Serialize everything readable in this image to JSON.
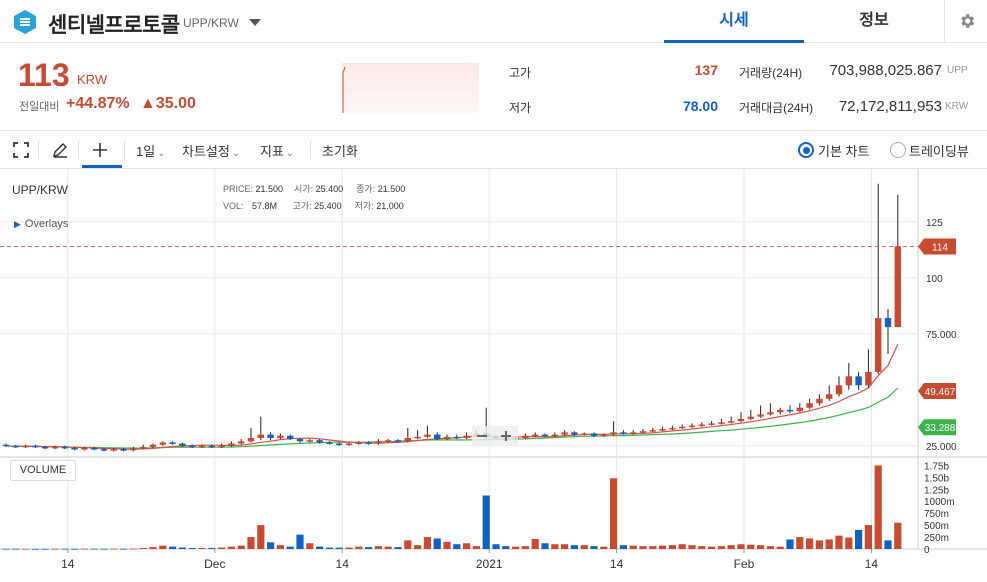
{
  "header": {
    "coin_name": "센티넬프로토콜",
    "pair": "UPP/KRW",
    "tabs": [
      "시세",
      "정보"
    ]
  },
  "price": {
    "current": "113",
    "unit": "KRW",
    "change_label": "전일대비",
    "change_pct": "+44.87%",
    "change_amt": "▲35.00"
  },
  "stats": {
    "high_label": "고가",
    "high_value": "137",
    "low_label": "저가",
    "low_value": "78.00",
    "volume_label": "거래량(24H)",
    "volume_value": "703,988,025.867",
    "volume_unit": "UPP",
    "amount_label": "거래대금(24H)",
    "amount_value": "72,172,811,953",
    "amount_unit": "KRW"
  },
  "toolbar": {
    "interval": "1일",
    "chart_settings": "차트설정",
    "indicators": "지표",
    "reset": "초기화",
    "basic_chart": "기본 차트",
    "trading_view": "트레이딩뷰"
  },
  "colors": {
    "up": "#c84a31",
    "down": "#1261c4",
    "ma_short": "#d9534f",
    "ma_long": "#3cb44b"
  },
  "chart": {
    "symbol": "UPP/KRW",
    "overlays": "Overlays",
    "volume_label": "VOLUME",
    "ohlc": {
      "price_k": "PRICE:",
      "price_v": "21.500",
      "open_k": "시가:",
      "open_v": "25.400",
      "close_k": "종가:",
      "close_v": "21.500",
      "vol_k": "VOL:",
      "vol_v": "57.8M",
      "high_k": "고가:",
      "high_v": "25.400",
      "low_k": "저가:",
      "low_v": "21.000"
    },
    "y_ticks": [
      "125",
      "100",
      "75.000",
      "25.000"
    ],
    "vol_ticks": [
      "1.75b",
      "1.50b",
      "1.25b",
      "1000m",
      "750m",
      "500m",
      "250m",
      "0"
    ],
    "x_ticks": [
      "14",
      "Dec",
      "14",
      "2021",
      "14",
      "Feb",
      "14"
    ],
    "price_tags": [
      {
        "label": "114",
        "value": 114,
        "color": "#c84a31"
      },
      {
        "label": "49.467",
        "value": 49.467,
        "color": "#c84a31"
      },
      {
        "label": "33.288",
        "value": 33.288,
        "color": "#3cb44b"
      }
    ]
  },
  "chart_data": {
    "type": "candlestick",
    "y_range": [
      20,
      145
    ],
    "vol_range": [
      0,
      1.8
    ],
    "candles": [
      [
        0,
        25.5,
        25.0,
        26.0,
        24.5,
        0.005
      ],
      [
        1,
        25.0,
        24.5,
        25.5,
        24.0,
        0.004
      ],
      [
        2,
        24.5,
        25.0,
        25.5,
        24.0,
        0.004
      ],
      [
        3,
        25.0,
        24.5,
        25.5,
        24.0,
        0.003
      ],
      [
        4,
        24.5,
        24.0,
        25.0,
        23.5,
        0.003
      ],
      [
        5,
        24.0,
        24.5,
        25.0,
        23.5,
        0.004
      ],
      [
        6,
        24.5,
        24.0,
        25.0,
        23.5,
        0.005
      ],
      [
        7,
        24.0,
        23.5,
        24.5,
        23.0,
        0.004
      ],
      [
        8,
        23.5,
        24.0,
        24.5,
        23.0,
        0.006
      ],
      [
        9,
        24.0,
        23.5,
        24.5,
        23.0,
        0.005
      ],
      [
        10,
        23.5,
        23.0,
        24.0,
        22.5,
        0.004
      ],
      [
        11,
        23.0,
        23.5,
        24.0,
        22.5,
        0.006
      ],
      [
        12,
        23.5,
        23.0,
        24.0,
        22.5,
        0.005
      ],
      [
        13,
        23.0,
        23.8,
        24.5,
        22.5,
        0.008
      ],
      [
        14,
        23.8,
        24.5,
        25.5,
        23.5,
        0.02
      ],
      [
        15,
        24.5,
        25.5,
        26.0,
        24.0,
        0.04
      ],
      [
        16,
        25.5,
        26.5,
        27.0,
        25.0,
        0.07
      ],
      [
        17,
        26.5,
        26.0,
        27.0,
        25.5,
        0.05
      ],
      [
        18,
        26.0,
        25.0,
        26.5,
        24.5,
        0.03
      ],
      [
        19,
        25.0,
        24.5,
        25.5,
        24.0,
        0.02
      ],
      [
        20,
        24.5,
        25.0,
        25.5,
        24.0,
        0.02
      ],
      [
        21,
        25.0,
        24.5,
        25.5,
        24.0,
        0.02
      ],
      [
        22,
        24.5,
        25.0,
        26.0,
        24.0,
        0.03
      ],
      [
        23,
        25.0,
        26.0,
        27.0,
        24.5,
        0.05
      ],
      [
        24,
        26.0,
        27.0,
        28.0,
        25.5,
        0.07
      ],
      [
        25,
        27.0,
        28.5,
        33.0,
        26.5,
        0.25
      ],
      [
        26,
        28.5,
        30.0,
        38.0,
        27.5,
        0.5
      ],
      [
        27,
        30.0,
        28.5,
        31.0,
        27.5,
        0.14
      ],
      [
        28,
        28.5,
        29.5,
        30.5,
        28.0,
        0.08
      ],
      [
        29,
        29.5,
        28.0,
        30.0,
        27.5,
        0.05
      ],
      [
        30,
        28.0,
        27.0,
        28.5,
        26.5,
        0.3
      ],
      [
        31,
        27.0,
        27.5,
        28.0,
        26.5,
        0.12
      ],
      [
        32,
        27.5,
        26.5,
        28.0,
        26.0,
        0.05
      ],
      [
        33,
        26.5,
        26.0,
        27.0,
        25.5,
        0.03
      ],
      [
        34,
        26.0,
        25.5,
        26.5,
        25.0,
        0.03
      ],
      [
        35,
        25.5,
        26.0,
        26.5,
        25.0,
        0.03
      ],
      [
        36,
        26.0,
        26.5,
        27.0,
        25.5,
        0.05
      ],
      [
        37,
        26.5,
        26.0,
        27.0,
        25.5,
        0.04
      ],
      [
        38,
        26.0,
        27.0,
        28.0,
        25.5,
        0.06
      ],
      [
        39,
        27.0,
        27.5,
        28.0,
        26.5,
        0.05
      ],
      [
        40,
        27.5,
        27.0,
        28.0,
        26.5,
        0.04
      ],
      [
        41,
        27.0,
        28.5,
        33.0,
        26.5,
        0.18
      ],
      [
        42,
        28.5,
        29.0,
        32.0,
        28.0,
        0.08
      ],
      [
        43,
        29.0,
        30.0,
        34.0,
        28.5,
        0.25
      ],
      [
        44,
        30.0,
        28.0,
        31.0,
        27.5,
        0.22
      ],
      [
        45,
        28.0,
        29.0,
        30.0,
        27.5,
        0.15
      ],
      [
        46,
        29.0,
        28.5,
        30.0,
        28.0,
        0.1
      ],
      [
        47,
        28.5,
        29.5,
        31.0,
        28.0,
        0.12
      ],
      [
        48,
        29.5,
        30.5,
        32.0,
        29.0,
        0.06
      ],
      [
        49,
        30.5,
        29.0,
        42.0,
        28.0,
        1.12
      ],
      [
        50,
        29.0,
        28.5,
        30.0,
        28.0,
        0.1
      ],
      [
        51,
        28.5,
        28.0,
        29.0,
        27.5,
        0.06
      ],
      [
        52,
        28.0,
        28.5,
        29.5,
        27.5,
        0.05
      ],
      [
        53,
        28.5,
        29.5,
        30.5,
        28.0,
        0.06
      ],
      [
        54,
        29.5,
        30.0,
        31.0,
        29.0,
        0.21
      ],
      [
        55,
        30.0,
        29.5,
        30.5,
        29.0,
        0.12
      ],
      [
        56,
        29.5,
        30.0,
        31.0,
        29.0,
        0.1
      ],
      [
        57,
        30.0,
        31.0,
        32.0,
        29.5,
        0.1
      ],
      [
        58,
        31.0,
        30.0,
        31.5,
        29.5,
        0.08
      ],
      [
        59,
        30.0,
        30.5,
        31.0,
        29.5,
        0.08
      ],
      [
        60,
        30.5,
        29.5,
        31.0,
        29.0,
        0.06
      ],
      [
        61,
        29.5,
        30.0,
        30.5,
        29.0,
        0.05
      ],
      [
        62,
        30.0,
        31.0,
        36.0,
        29.5,
        1.48
      ],
      [
        63,
        31.0,
        30.5,
        32.0,
        30.0,
        0.08
      ],
      [
        64,
        30.5,
        31.0,
        32.0,
        30.0,
        0.07
      ],
      [
        65,
        31.0,
        31.5,
        32.5,
        30.5,
        0.06
      ],
      [
        66,
        31.5,
        32.0,
        33.0,
        31.0,
        0.06
      ],
      [
        67,
        32.0,
        32.5,
        33.5,
        31.5,
        0.07
      ],
      [
        68,
        32.5,
        33.0,
        34.0,
        32.0,
        0.08
      ],
      [
        69,
        33.0,
        33.5,
        34.5,
        32.5,
        0.1
      ],
      [
        70,
        33.5,
        34.0,
        35.0,
        33.0,
        0.08
      ],
      [
        71,
        34.0,
        34.5,
        35.5,
        33.5,
        0.06
      ],
      [
        72,
        34.5,
        35.0,
        36.0,
        34.0,
        0.05
      ],
      [
        73,
        35.0,
        35.5,
        37.0,
        34.5,
        0.06
      ],
      [
        74,
        35.5,
        36.0,
        38.0,
        35.0,
        0.08
      ],
      [
        75,
        36.0,
        37.0,
        40.0,
        35.5,
        0.1
      ],
      [
        76,
        37.0,
        38.0,
        41.0,
        36.5,
        0.09
      ],
      [
        77,
        38.0,
        39.0,
        43.0,
        37.5,
        0.08
      ],
      [
        78,
        39.0,
        40.0,
        44.0,
        38.5,
        0.06
      ],
      [
        79,
        40.0,
        41.0,
        42.0,
        39.0,
        0.05
      ],
      [
        80,
        41.0,
        40.5,
        43.0,
        39.5,
        0.2
      ],
      [
        81,
        40.5,
        42.0,
        44.0,
        40.0,
        0.25
      ],
      [
        82,
        42.0,
        44.0,
        46.0,
        41.5,
        0.22
      ],
      [
        83,
        44.0,
        46.0,
        48.0,
        43.0,
        0.18
      ],
      [
        84,
        46.0,
        48.0,
        52.0,
        45.0,
        0.2
      ],
      [
        85,
        48.0,
        52.0,
        56.0,
        47.0,
        0.28
      ],
      [
        86,
        52.0,
        56.0,
        62.0,
        50.0,
        0.24
      ],
      [
        87,
        56.0,
        52.0,
        58.0,
        50.0,
        0.4
      ],
      [
        88,
        52.0,
        58.0,
        68.0,
        51.0,
        0.5
      ],
      [
        89,
        58.0,
        82.0,
        142.0,
        57.0,
        1.75
      ],
      [
        90,
        82.0,
        78.0,
        86.0,
        66.0,
        0.18
      ],
      [
        91,
        78.0,
        114.0,
        137.0,
        78.0,
        0.55
      ]
    ]
  }
}
